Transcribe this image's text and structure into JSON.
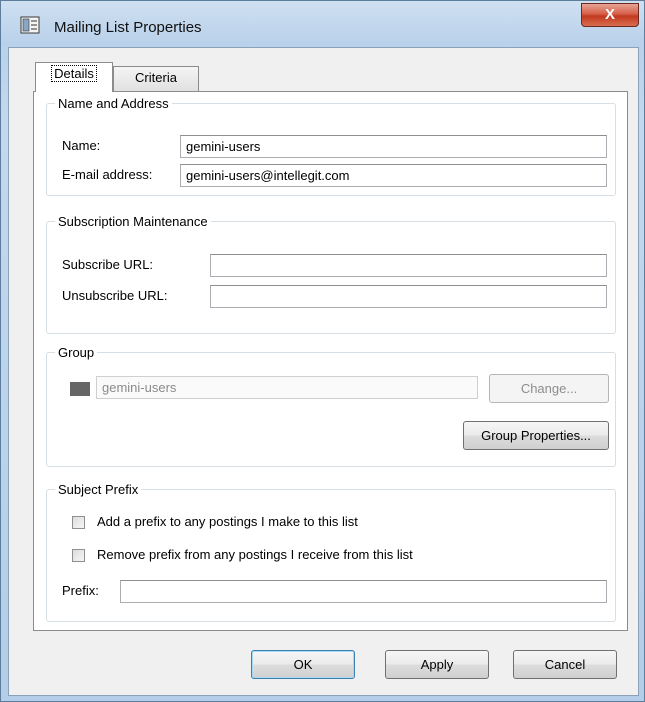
{
  "window": {
    "title": "Mailing List Properties",
    "close_label": "X"
  },
  "tabs": [
    {
      "label": "Details",
      "active": true
    },
    {
      "label": "Criteria",
      "active": false
    }
  ],
  "name_address": {
    "legend": "Name and Address",
    "name_label": "Name:",
    "name_value": "gemini-users",
    "email_label": "E-mail address:",
    "email_value": "gemini-users@intellegit.com"
  },
  "subscription": {
    "legend": "Subscription Maintenance",
    "subscribe_label": "Subscribe URL:",
    "subscribe_value": "",
    "unsubscribe_label": "Unsubscribe URL:",
    "unsubscribe_value": ""
  },
  "group": {
    "legend": "Group",
    "swatch_color": "#666666",
    "group_value": "gemini-users",
    "change_label": "Change...",
    "properties_label": "Group Properties..."
  },
  "subject_prefix": {
    "legend": "Subject Prefix",
    "add_prefix_label": "Add a prefix to any postings I make to this list",
    "add_prefix_checked": false,
    "remove_prefix_label": "Remove prefix from any postings I receive from this list",
    "remove_prefix_checked": false,
    "prefix_label": "Prefix:",
    "prefix_value": ""
  },
  "buttons": {
    "ok": "OK",
    "apply": "Apply",
    "cancel": "Cancel"
  }
}
